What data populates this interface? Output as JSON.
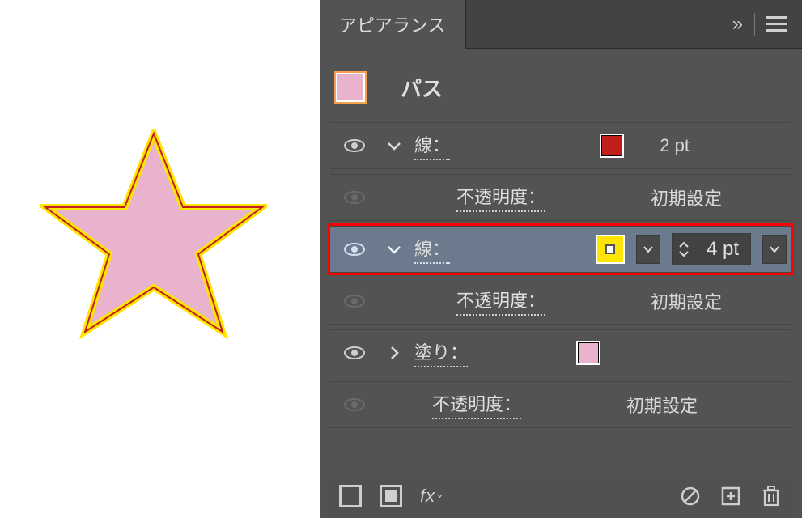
{
  "panel": {
    "title_tab": "アピアランス",
    "collapse": "»"
  },
  "object": {
    "type_label": "パス",
    "preview_fill": "#e9b3ce",
    "preview_stroke": "#f7a14b"
  },
  "rows": [
    {
      "id": "stroke1",
      "label": "線：",
      "swatch": "#c21e1e",
      "weight": "2 pt",
      "expanded": true,
      "selected": false,
      "vis": true
    },
    {
      "id": "stroke1-op",
      "kind": "opacity",
      "label": "不透明度：",
      "value": "初期設定",
      "vis": false
    },
    {
      "id": "stroke2",
      "label": "線：",
      "swatch": "#ffe600",
      "weight": "4 pt",
      "expanded": true,
      "selected": true,
      "vis": true,
      "highlight": true
    },
    {
      "id": "stroke2-op",
      "kind": "opacity",
      "label": "不透明度：",
      "value": "初期設定",
      "vis": false
    },
    {
      "id": "fill1",
      "label": "塗り：",
      "swatch": "#e9b3ce",
      "expanded": false,
      "selected": false,
      "vis": true
    },
    {
      "id": "obj-op",
      "kind": "opacity",
      "label": "不透明度：",
      "value": "初期設定",
      "vis": false
    }
  ],
  "footer": {
    "fx": "fx"
  }
}
